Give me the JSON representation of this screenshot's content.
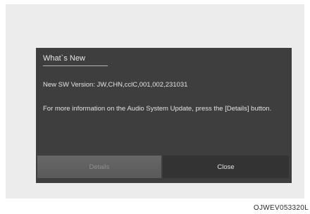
{
  "dialog": {
    "title": "What`s New",
    "version_line": "New SW Version: JW,CHN,cclC,001,002,231031",
    "info_text": "For more information on the Audio System Update, press the [Details] button.",
    "buttons": {
      "details_label": "Details",
      "close_label": "Close"
    }
  },
  "image_code": "OJWEV053320L"
}
